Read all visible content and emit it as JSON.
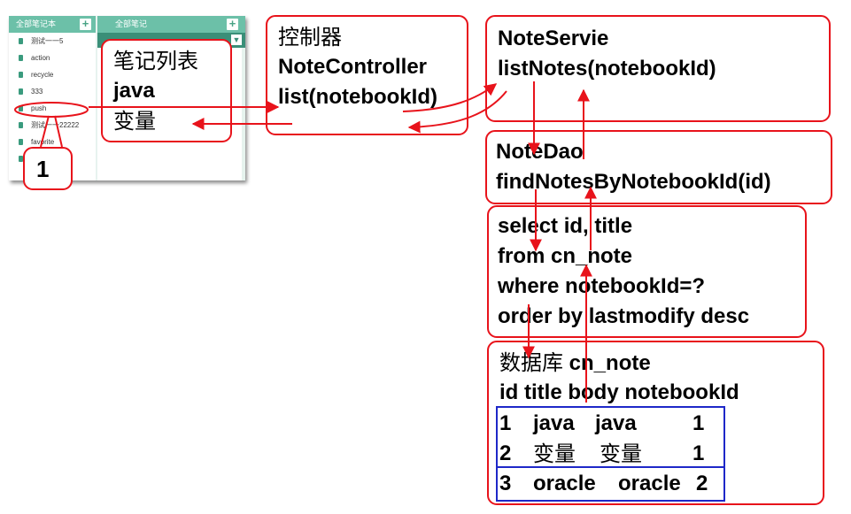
{
  "app": {
    "left_header": "全部笔记本",
    "right_header": "全部笔记",
    "add_icon": "plus-icon",
    "notebooks": [
      "测试一一5",
      "action",
      "recycle",
      "333",
      "push",
      "测试一一22222",
      "favorite",
      ""
    ]
  },
  "popup_list": [
    "笔记列表",
    "java",
    "变量"
  ],
  "marker_label": "1",
  "controller": [
    "控制器",
    "NoteController",
    "list(notebookId)"
  ],
  "service": [
    "NoteServie",
    "listNotes(notebookId)"
  ],
  "dao": [
    "NoteDao",
    "findNotesByNotebookId(id)"
  ],
  "sql": [
    "select id, title",
    "from cn_note",
    "where notebookId=?",
    "order by lastmodify desc"
  ],
  "database": {
    "title_prefix": "数据库",
    "title_table": "cn_note",
    "header": "id title body notebookId",
    "rows": [
      [
        "1",
        "java",
        "java",
        "1"
      ],
      [
        "2",
        "变量",
        "变量",
        "1"
      ],
      [
        "3",
        "oracle",
        "oracle",
        "2"
      ]
    ]
  },
  "colors": {
    "arrow": "#e8131b",
    "highlight": "#1e28c8",
    "app_header": "#6cc0a8"
  }
}
